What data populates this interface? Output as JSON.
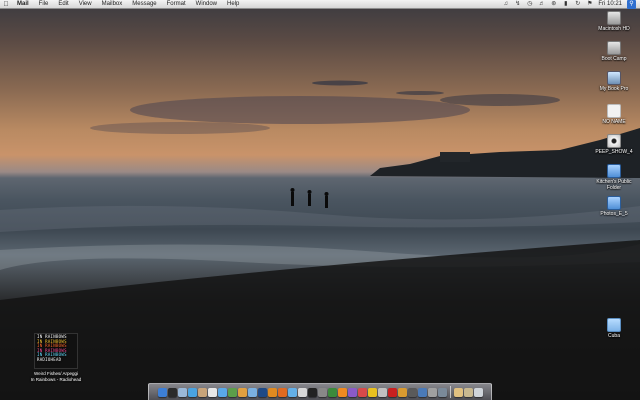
{
  "menubar": {
    "apple_icon": "apple-icon",
    "items": [
      {
        "label": "Mail",
        "app": true
      },
      {
        "label": "File"
      },
      {
        "label": "Edit"
      },
      {
        "label": "View"
      },
      {
        "label": "Mailbox"
      },
      {
        "label": "Message"
      },
      {
        "label": "Format"
      },
      {
        "label": "Window"
      },
      {
        "label": "Help"
      }
    ],
    "extras": {
      "clock": "Fri 10:21",
      "icons": [
        "itunes-icon",
        "bluetooth-icon",
        "time-machine-icon",
        "volume-icon",
        "wifi-icon",
        "battery-icon",
        "sync-icon",
        "flag-icon"
      ],
      "spotlight_icon": "spotlight-icon"
    }
  },
  "desktop_icons": [
    {
      "label": "Macintosh HD",
      "icon": "hard-drive-icon"
    },
    {
      "label": "Boot Camp",
      "icon": "hard-drive-icon"
    },
    {
      "label": "My Book Pro",
      "icon": "external-drive-icon"
    },
    {
      "label": "NO NAME",
      "icon": "blank-disk-icon"
    },
    {
      "label": "PEEP_SHOW_4",
      "icon": "cd-icon"
    },
    {
      "label": "Kitchen's Public Folder",
      "icon": "shared-folder-icon"
    },
    {
      "label": "Photos_E_5",
      "icon": "shared-folder-icon"
    },
    {
      "label": "Cuba",
      "icon": "folder-icon"
    }
  ],
  "now_playing": {
    "album_art_lines": [
      "IN RAINBOWS",
      "IN RAINBOWS",
      "IN RAINBOWS",
      "IN RAINBOWS",
      "IN RAINBOWS",
      "RADIOHEAD"
    ],
    "track": "Weird Fishes/ Arpeggi",
    "album_artist": "In Rainbows - Radiohead"
  },
  "dock": {
    "apps": [
      {
        "name": "finder",
        "color": "#3d7fd6"
      },
      {
        "name": "dashboard",
        "color": "#2b2b2b"
      },
      {
        "name": "mail",
        "color": "#9ab8d8"
      },
      {
        "name": "safari",
        "color": "#4aa3e0"
      },
      {
        "name": "address-book",
        "color": "#c8a47a"
      },
      {
        "name": "ical",
        "color": "#e8e8e8"
      },
      {
        "name": "itunes",
        "color": "#5aa8e8"
      },
      {
        "name": "iphoto",
        "color": "#5c9e4a"
      },
      {
        "name": "garageband",
        "color": "#e0a040"
      },
      {
        "name": "preview",
        "color": "#7ab0e0"
      },
      {
        "name": "photoshop",
        "color": "#1f4a86"
      },
      {
        "name": "illustrator",
        "color": "#e08a20"
      },
      {
        "name": "firefox",
        "color": "#e06a20"
      },
      {
        "name": "ichat",
        "color": "#64b0e8"
      },
      {
        "name": "textedit",
        "color": "#d8d8d8"
      },
      {
        "name": "terminal",
        "color": "#222222"
      },
      {
        "name": "system-preferences",
        "color": "#888888"
      },
      {
        "name": "activity-monitor",
        "color": "#3c8a3c"
      },
      {
        "name": "vlc",
        "color": "#f08a20"
      },
      {
        "name": "app-store",
        "color": "#8a5ac8"
      },
      {
        "name": "ftp-client",
        "color": "#d84a4a"
      },
      {
        "name": "toast",
        "color": "#e8c020"
      },
      {
        "name": "utility",
        "color": "#c0c0c0"
      },
      {
        "name": "acrobat",
        "color": "#c82020"
      },
      {
        "name": "handbrake",
        "color": "#d89a30"
      },
      {
        "name": "calculator",
        "color": "#5a5a5a"
      },
      {
        "name": "quicktime",
        "color": "#4a7ab8"
      },
      {
        "name": "disk-utility",
        "color": "#a0a0a0"
      },
      {
        "name": "network-utility",
        "color": "#7a8a9a"
      }
    ],
    "right": [
      {
        "name": "documents-stack",
        "color": "#e0c080"
      },
      {
        "name": "downloads-stack",
        "color": "#c8b890"
      },
      {
        "name": "trash",
        "color": "#cfd4da"
      }
    ]
  }
}
